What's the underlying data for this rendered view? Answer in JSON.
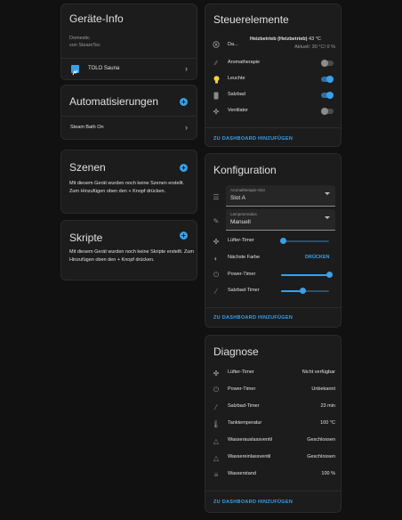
{
  "device_info": {
    "title": "Geräte-Info",
    "model": "Domestic",
    "manufacturer": "von SteamTec",
    "device_name": "TOLO Sauna"
  },
  "automations": {
    "title": "Automatisierungen",
    "items": [
      "Steam Bath On"
    ]
  },
  "scenes": {
    "title": "Szenen",
    "description": "Mit diesem Gerät wurden noch keine Szenen erstellt. Zum Hinzufügen oben den + Knopf drücken."
  },
  "scripts": {
    "title": "Skripte",
    "description": "Mit diesem Gerät wurden noch keine Skripte erstellt. Zum Hinzufügen oben den + Knopf drücken."
  },
  "controls": {
    "title": "Steuerelemente",
    "climate": {
      "label": "Da...",
      "state": "Heizbetrieb (Heizbetrieb)",
      "target": "43 °C",
      "current": "Aktuell: 30 °C/ 0 %"
    },
    "toggles": [
      {
        "label": "Aromatherapie",
        "on": false,
        "icon": "aroma-icon"
      },
      {
        "label": "Leuchte",
        "on": true,
        "icon": "lightbulb-icon"
      },
      {
        "label": "Salzbad",
        "on": true,
        "icon": "salt-bath-icon"
      },
      {
        "label": "Ventilator",
        "on": false,
        "icon": "fan-icon"
      }
    ],
    "footer": "ZU DASHBOARD HINZUFÜGEN"
  },
  "configuration": {
    "title": "Konfiguration",
    "selects": [
      {
        "caption": "Aromatherapie-Slot",
        "value": "Slot A"
      },
      {
        "caption": "Lampenmodus",
        "value": "Manuell"
      }
    ],
    "sliders": [
      {
        "label": "Lüfter-Timer",
        "level": 0.05
      },
      {
        "label": "Power-Timer",
        "level": 1.0
      },
      {
        "label": "Salzbad-Timer",
        "level": 0.45
      }
    ],
    "next_color": {
      "label": "Nächste Farbe",
      "button": "DRÜCKEN"
    },
    "footer": "ZU DASHBOARD HINZUFÜGEN"
  },
  "diagnosis": {
    "title": "Diagnose",
    "rows": [
      {
        "label": "Lüfter-Timer",
        "value": "Nicht verfügbar"
      },
      {
        "label": "Power-Timer",
        "value": "Unbekannt"
      },
      {
        "label": "Salzbad-Timer",
        "value": "23 min"
      },
      {
        "label": "Tanktemperatur",
        "value": "100 °C"
      },
      {
        "label": "Wasserauslassventil",
        "value": "Geschlossen"
      },
      {
        "label": "Wassereinlassventil",
        "value": "Geschlossen"
      },
      {
        "label": "Wasserstand",
        "value": "100 %"
      }
    ],
    "footer": "ZU DASHBOARD HINZUFÜGEN"
  },
  "colors": {
    "accent": "#3aa0e8",
    "card": "#1c1c1c",
    "background": "#111111"
  }
}
